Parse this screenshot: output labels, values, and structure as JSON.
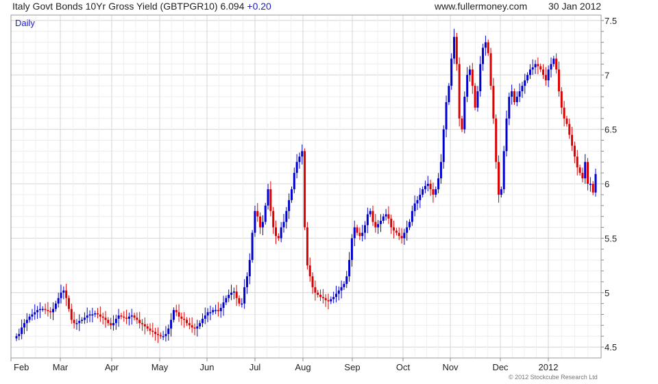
{
  "header": {
    "title": "Italy Govt Bonds 10Yr Gross Yield (GBTPGR10)",
    "last_value": "6.094",
    "change": "+0.20",
    "site": "www.fullermoney.com",
    "date": "30 Jan 2012"
  },
  "footer": {
    "copyright": "© 2012 Stockcube Research Ltd"
  },
  "colors": {
    "up": "#0000cc",
    "down": "#dd0000",
    "grid": "#dddddd",
    "frame": "#999999",
    "text": "#222222"
  },
  "chart_data": {
    "type": "line",
    "label": "Daily",
    "title": "",
    "xlabel": "",
    "ylabel": "",
    "ylim": [
      4.4,
      7.55
    ],
    "yticks": [
      "4.5",
      "5",
      "5.5",
      "6",
      "6.5",
      "7",
      "7.5"
    ],
    "ytick_values": [
      4.5,
      5,
      5.5,
      6,
      6.5,
      7,
      7.5
    ],
    "xticks": [
      "Feb",
      "Mar",
      "Apr",
      "May",
      "Jun",
      "Jul",
      "Aug",
      "Sep",
      "Oct",
      "Nov",
      "Dec",
      "2012"
    ],
    "grid": true,
    "up_color": "#0000cc",
    "down_color": "#dd0000",
    "series": [
      {
        "values": [
          4.6,
          4.62,
          4.68,
          4.72,
          4.75,
          4.78,
          4.8,
          4.82,
          4.84,
          4.85,
          4.85,
          4.84,
          4.83,
          4.82,
          4.85,
          4.9,
          4.95,
          5.0,
          5.02,
          4.95,
          4.85,
          4.75,
          4.72,
          4.72,
          4.74,
          4.75,
          4.77,
          4.79,
          4.8,
          4.8,
          4.81,
          4.8,
          4.78,
          4.77,
          4.75,
          4.72,
          4.7,
          4.72,
          4.76,
          4.79,
          4.78,
          4.77,
          4.76,
          4.78,
          4.79,
          4.77,
          4.75,
          4.72,
          4.71,
          4.69,
          4.67,
          4.65,
          4.64,
          4.62,
          4.61,
          4.6,
          4.6,
          4.62,
          4.67,
          4.75,
          4.84,
          4.82,
          4.78,
          4.76,
          4.75,
          4.72,
          4.7,
          4.68,
          4.67,
          4.69,
          4.72,
          4.76,
          4.79,
          4.82,
          4.82,
          4.84,
          4.84,
          4.83,
          4.86,
          4.91,
          4.95,
          4.98,
          5.0,
          5.01,
          4.95,
          4.9,
          4.9,
          5.05,
          5.15,
          5.3,
          5.55,
          5.75,
          5.7,
          5.6,
          5.65,
          5.8,
          5.95,
          5.75,
          5.6,
          5.52,
          5.5,
          5.6,
          5.65,
          5.75,
          5.85,
          5.95,
          6.1,
          6.2,
          6.25,
          6.3,
          5.6,
          5.25,
          5.15,
          5.05,
          5.0,
          4.98,
          4.96,
          4.95,
          4.93,
          4.92,
          4.94,
          4.96,
          4.99,
          5.02,
          5.05,
          5.08,
          5.15,
          5.3,
          5.5,
          5.6,
          5.55,
          5.52,
          5.55,
          5.62,
          5.72,
          5.75,
          5.65,
          5.6,
          5.63,
          5.66,
          5.7,
          5.72,
          5.68,
          5.6,
          5.57,
          5.55,
          5.52,
          5.5,
          5.55,
          5.6,
          5.65,
          5.75,
          5.82,
          5.85,
          5.9,
          5.95,
          5.98,
          6.0,
          5.95,
          5.9,
          5.95,
          6.05,
          6.2,
          6.5,
          6.75,
          6.9,
          7.15,
          7.35,
          7.1,
          6.6,
          6.5,
          6.8,
          7.0,
          7.05,
          6.9,
          6.7,
          6.85,
          7.1,
          7.25,
          7.3,
          7.2,
          6.9,
          6.6,
          6.2,
          5.9,
          5.95,
          6.3,
          6.6,
          6.8,
          6.85,
          6.75,
          6.8,
          6.85,
          6.9,
          6.95,
          7.0,
          7.05,
          7.07,
          7.1,
          7.08,
          7.05,
          7.0,
          6.95,
          7.05,
          7.1,
          7.15,
          7.05,
          6.85,
          6.7,
          6.6,
          6.55,
          6.45,
          6.35,
          6.25,
          6.15,
          6.1,
          6.05,
          6.2,
          6.0,
          6.0,
          5.92,
          6.09
        ]
      }
    ]
  }
}
